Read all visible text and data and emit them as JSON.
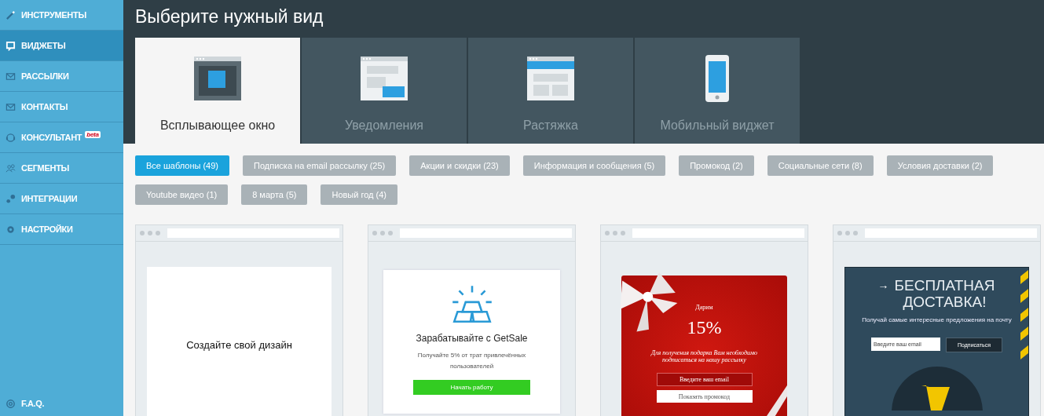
{
  "sidebar": {
    "items": [
      {
        "label": "ИНСТРУМЕНТЫ",
        "selected": false
      },
      {
        "label": "ВИДЖЕТЫ",
        "selected": true
      },
      {
        "label": "РАССЫЛКИ",
        "selected": false
      },
      {
        "label": "КОНТАКТЫ",
        "selected": false
      },
      {
        "label": "КОНСУЛЬТАНТ",
        "selected": false,
        "badge": "beta"
      },
      {
        "label": "СЕГМЕНТЫ",
        "selected": false
      },
      {
        "label": "ИНТЕГРАЦИИ",
        "selected": false
      },
      {
        "label": "НАСТРОЙКИ",
        "selected": false
      }
    ],
    "footer": "F.A.Q."
  },
  "header": {
    "title": "Выберите нужный вид"
  },
  "tabs": [
    {
      "label": "Всплывающее окно",
      "selected": true
    },
    {
      "label": "Уведомления",
      "selected": false
    },
    {
      "label": "Растяжка",
      "selected": false
    },
    {
      "label": "Мобильный виджет",
      "selected": false
    }
  ],
  "filters": [
    {
      "label": "Все шаблоны (49)",
      "selected": true
    },
    {
      "label": "Подписка на email рассылку (25)",
      "selected": false
    },
    {
      "label": "Акции и скидки (23)",
      "selected": false
    },
    {
      "label": "Информация и сообщения (5)",
      "selected": false
    },
    {
      "label": "Промокод (2)",
      "selected": false
    },
    {
      "label": "Социальные сети (8)",
      "selected": false
    },
    {
      "label": "Условия доставки (2)",
      "selected": false
    },
    {
      "label": "Youtube видео (1)",
      "selected": false
    },
    {
      "label": "8 марта (5)",
      "selected": false
    },
    {
      "label": "Новый год (4)",
      "selected": false
    }
  ],
  "templates": [
    {
      "kind": "blank",
      "title": "Создайте свой дизайн"
    },
    {
      "kind": "promo",
      "title": "Зарабатывайте с GetSale",
      "text": "Получайте 5% от трат привлечённых пользователей",
      "button": "Начать работу"
    },
    {
      "kind": "gift",
      "title": "Дарим",
      "value": "15%",
      "text": "Для получения подарка Вам необходимо подписаться на нашу рассылку",
      "placeholder": "Введите ваш email",
      "button": "Показать промокод"
    },
    {
      "kind": "delivery",
      "arrow": "→",
      "title": "БЕСПЛАТНАЯ ДОСТАВКА!",
      "text": "Получай самые интересные предложения на почту",
      "placeholder": "Введите ваш email",
      "button": "Подписаться"
    }
  ]
}
